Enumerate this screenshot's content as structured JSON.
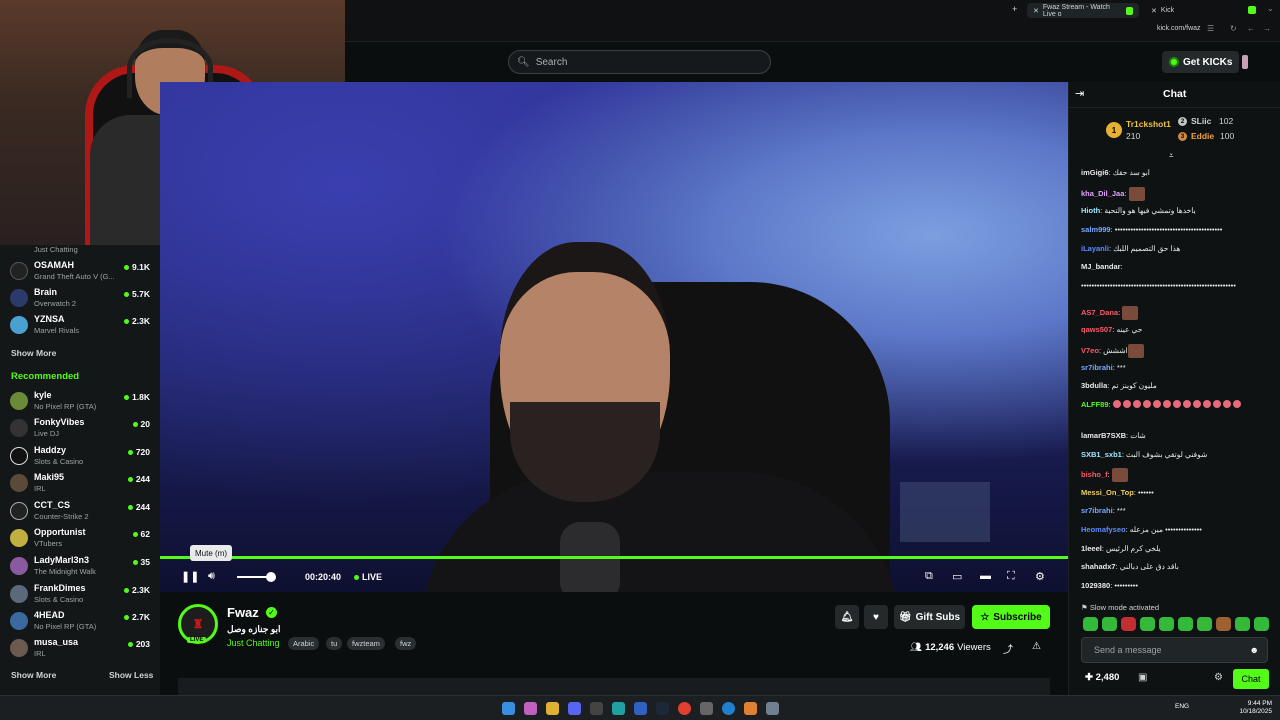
{
  "browser": {
    "tabs": [
      {
        "label": "Fwaz Stream - Watch Live o",
        "active": true
      },
      {
        "label": "Kick",
        "active": false
      }
    ],
    "url": "kick.com/fwaz"
  },
  "header": {
    "search_placeholder": "Search",
    "get_kicks": "Get KICKs"
  },
  "sidebar": {
    "top_category": "Just Chatting",
    "following": [
      {
        "name": "OSAMAH",
        "category": "Grand Theft Auto V (G...",
        "viewers": "9.1K"
      },
      {
        "name": "Brain",
        "category": "Overwatch 2",
        "viewers": "5.7K"
      },
      {
        "name": "YZNSA",
        "category": "Marvel Rivals",
        "viewers": "2.3K"
      }
    ],
    "show_more_1": "Show More",
    "recommended_title": "Recommended",
    "recommended": [
      {
        "name": "kyle",
        "category": "No Pixel RP (GTA)",
        "viewers": "1.8K"
      },
      {
        "name": "FonkyVibes",
        "category": "Live DJ",
        "viewers": "20"
      },
      {
        "name": "Haddzy",
        "category": "Slots & Casino",
        "viewers": "720"
      },
      {
        "name": "Maki95",
        "category": "IRL",
        "viewers": "244"
      },
      {
        "name": "CCT_CS",
        "category": "Counter-Strike 2",
        "viewers": "244"
      },
      {
        "name": "Opportunist",
        "category": "VTubers",
        "viewers": "62"
      },
      {
        "name": "LadyMarl3n3",
        "category": "The Midnight Walk",
        "viewers": "35"
      },
      {
        "name": "FrankDimes",
        "category": "Slots & Casino",
        "viewers": "2.3K"
      },
      {
        "name": "4HEAD",
        "category": "No Pixel RP (GTA)",
        "viewers": "2.7K"
      },
      {
        "name": "musa_usa",
        "category": "IRL",
        "viewers": "203"
      }
    ],
    "show_more_2": "Show More",
    "show_less": "Show Less"
  },
  "player": {
    "tooltip": "Mute (m)",
    "time": "00:20:40",
    "live": "LIVE",
    "volume": 0.85
  },
  "stream": {
    "channel": "Fwaz",
    "avatar_live": "LIVE",
    "title": "ابو جنازه وصل",
    "category": "Just Chatting",
    "tags": [
      "Arabic",
      "tu",
      "fwzteam",
      "fwz"
    ],
    "gift_subs": "Gift Subs",
    "subscribe": "Subscribe",
    "viewers": "12,246",
    "viewers_label": "Viewers"
  },
  "chat": {
    "title": "Chat",
    "leaderboard": [
      {
        "rank": "1",
        "name": "Tr1ckshot1",
        "count": "210"
      },
      {
        "rank": "2",
        "name": "SLiic",
        "count": "102"
      },
      {
        "rank": "3",
        "name": "Eddie",
        "count": "100"
      }
    ],
    "messages": [
      {
        "user": "imGigi6",
        "text": "ابو سد حقك",
        "color": "#e8eaeb"
      },
      {
        "user": "kha_Dil_Jaa",
        "text": "",
        "color": "#e6a0ff",
        "emote": true
      },
      {
        "user": "Hioth",
        "text": "ياخدها وتمشي فيها هو والتحية",
        "color": "#9fe8ff"
      },
      {
        "user": "salm999",
        "text": "•••••••••••••••••••••••••••••••••••••••••",
        "color": "#7aa8ff"
      },
      {
        "user": "iLayanli",
        "text": "هذا حق التصميم اللبك",
        "color": "#5d8cff"
      },
      {
        "user": "MJ_bandar",
        "text": "",
        "color": "#e8eaeb"
      },
      {
        "user": "",
        "text": "•••••••••••••••••••••••••••••••••••••••••••••••••••••••••••",
        "color": "#e8eaeb"
      },
      {
        "user": "AS7_Dana",
        "text": "",
        "color": "#ff5a6a",
        "emote": true
      },
      {
        "user": "qaws507",
        "text": "حي عينه",
        "color": "#ff5a6a"
      },
      {
        "user": "V7eo",
        "text": "اششش",
        "color": "#ff5a6a",
        "emote": true
      },
      {
        "user": "sr7ibrahi",
        "text": "***",
        "color": "#7aa8ff"
      },
      {
        "user": "3bdulla",
        "text": "مليون كوينز تم",
        "color": "#e8eaeb"
      },
      {
        "user": "ALFF89",
        "text": "",
        "color": "#53fc18",
        "dots": 13
      },
      {
        "user": "lamarB7SXB",
        "text": "شات",
        "color": "#e8eaeb"
      },
      {
        "user": "SXB1_sxb1",
        "text": "شوفني لوتقي بشوف البث",
        "color": "#9fe8ff"
      },
      {
        "user": "bisho_f",
        "text": "",
        "color": "#ff5a6a",
        "emote": true
      },
      {
        "user": "Messi_On_Top",
        "text": "••••••",
        "color": "#f0d060"
      },
      {
        "user": "sr7ibrahi",
        "text": "***",
        "color": "#7aa8ff"
      },
      {
        "user": "Heomafyseo",
        "text": "مين مزعله ••••••••••••••",
        "color": "#5d8cff"
      },
      {
        "user": "1leeel",
        "text": "يلخي كرم الرئيس",
        "color": "#e8eaeb"
      },
      {
        "user": "shahadx7",
        "text": "باقد دق على دبالني",
        "color": "#e8eaeb"
      },
      {
        "user": "1029380",
        "text": "•••••••••",
        "color": "#e8eaeb"
      }
    ],
    "slow_mode": "Slow mode activated",
    "send_placeholder": "Send a message",
    "points": "2,480",
    "chat_button": "Chat"
  },
  "taskbar": {
    "lang": "ENG",
    "time": "9:44 PM",
    "date": "10/18/2025"
  }
}
